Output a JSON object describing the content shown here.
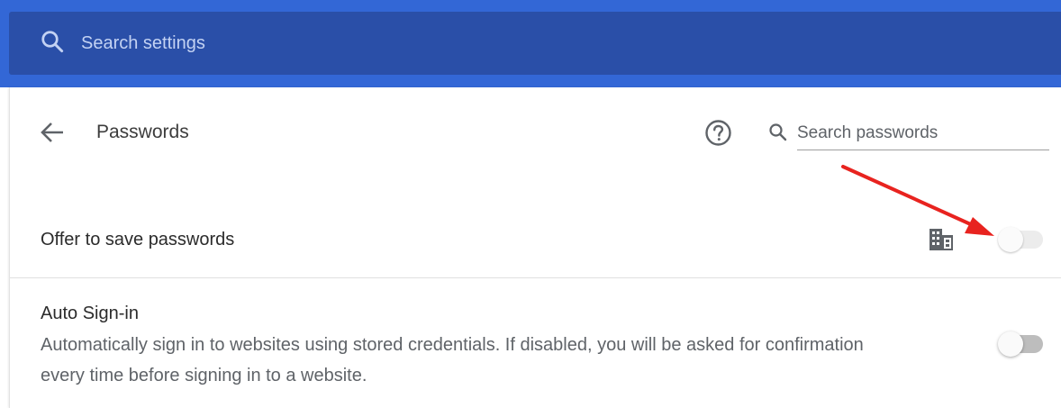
{
  "search": {
    "placeholder": "Search settings",
    "icon": "search-icon"
  },
  "header": {
    "title": "Passwords",
    "back_icon": "arrow-left-icon",
    "help_icon": "help-circle-icon",
    "search_passwords_placeholder": "Search passwords"
  },
  "settings": {
    "offer_to_save": {
      "label": "Offer to save passwords",
      "policy_icon": "enterprise-building-icon",
      "enabled": false,
      "managed": true
    },
    "auto_signin": {
      "title": "Auto Sign-in",
      "description": "Automatically sign in to websites using stored credentials. If disabled, you will be asked for confirmation every time before signing in to a website.",
      "enabled": false
    }
  },
  "colors": {
    "topbar": "#3367d6",
    "searchbox": "#2a4fa8",
    "annotation_arrow": "#e8231f"
  }
}
